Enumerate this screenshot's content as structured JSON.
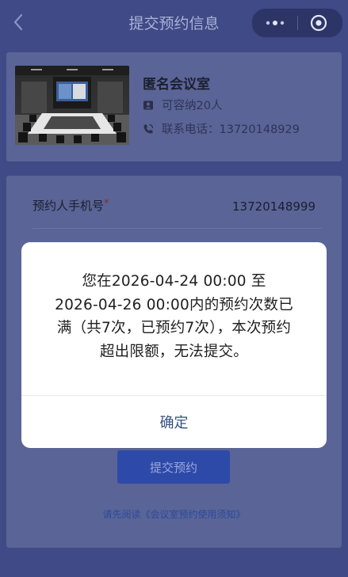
{
  "nav": {
    "title": "提交预约信息"
  },
  "room": {
    "name": "匿名会议室",
    "capacity": "可容纳20人",
    "phone": "联系电话：13720148929"
  },
  "form": {
    "phone_label": "预约人手机号",
    "required_mark": "*",
    "phone_value": "13720148999",
    "submit_label": "提交预约",
    "notice": "请先阅读《会议室预约使用须知》"
  },
  "modal": {
    "lines": [
      "您在2026-04-24 00:00 至",
      "2026-04-26 00:00内的预约次数已",
      "满（共7次，已预约7次），本次预约",
      "超出限额，无法提交。"
    ],
    "ok_label": "确定"
  },
  "colors": {
    "background_overlay": "#3f4a86",
    "card": "#5a6496",
    "primary_button": "#2e4aa8",
    "modal_ok_text": "#34507f"
  }
}
